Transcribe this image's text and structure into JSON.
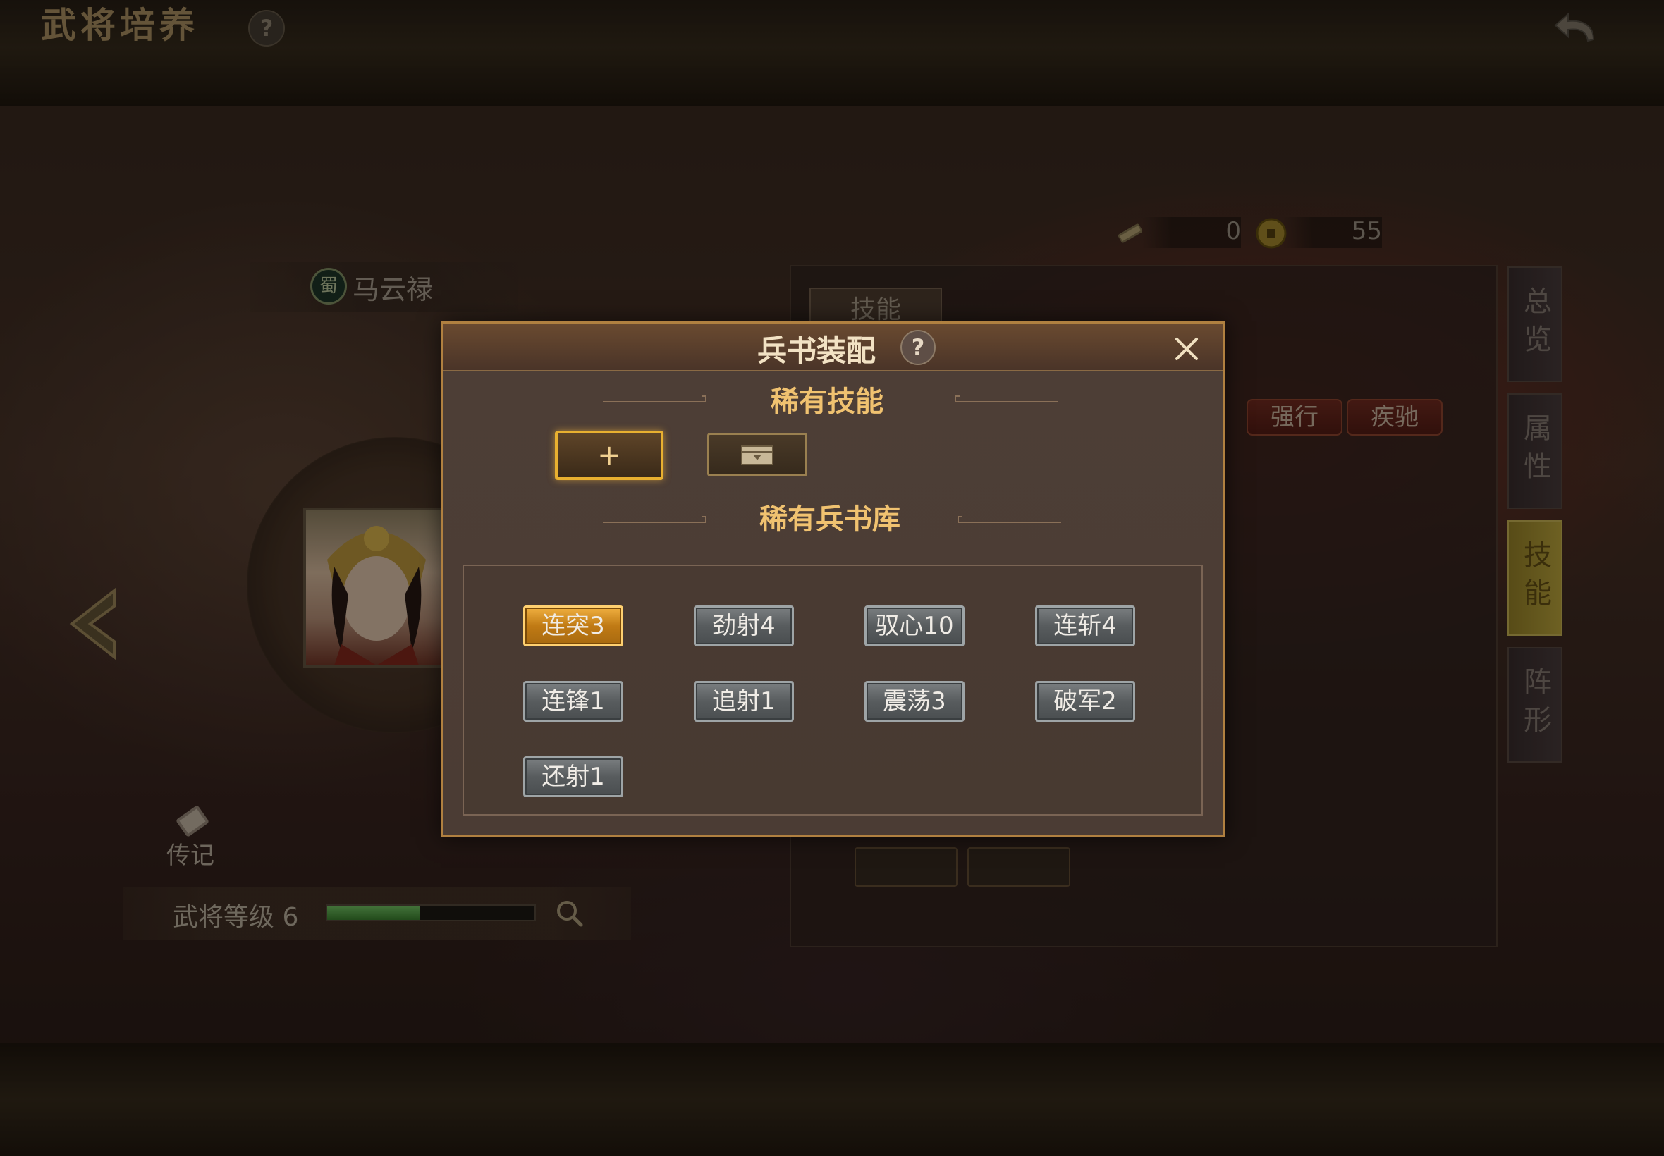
{
  "header": {
    "title": "武将培养",
    "help": "?"
  },
  "currency": [
    {
      "icon": "scroll-icon",
      "value": "0"
    },
    {
      "icon": "coin-icon",
      "value": "55"
    }
  ],
  "hero": {
    "faction": "蜀",
    "name": "马云禄",
    "bio_label": "传记",
    "level_label": "武将等级 6",
    "level_progress": 0.45
  },
  "background_panel": {
    "tab_label": "技能",
    "tags": [
      "强行",
      "疾驰"
    ]
  },
  "side_tabs": [
    {
      "label": "总览",
      "active": false
    },
    {
      "label": "属性",
      "active": false
    },
    {
      "label": "技能",
      "active": true
    },
    {
      "label": "阵形",
      "active": false
    }
  ],
  "modal": {
    "title": "兵书装配",
    "help": "?",
    "rare_skill_title": "稀有技能",
    "add_symbol": "+",
    "library_title": "稀有兵书库",
    "books": [
      {
        "label": "连突3",
        "selected": true
      },
      {
        "label": "劲射4",
        "selected": false
      },
      {
        "label": "驭心10",
        "selected": false
      },
      {
        "label": "连斩4",
        "selected": false
      },
      {
        "label": "连锋1",
        "selected": false
      },
      {
        "label": "追射1",
        "selected": false
      },
      {
        "label": "震荡3",
        "selected": false
      },
      {
        "label": "破军2",
        "selected": false
      },
      {
        "label": "还射1",
        "selected": false
      }
    ]
  },
  "colors": {
    "accent_gold": "#f0c270",
    "selected_book": "#e0a030",
    "progress_green": "#5fb04e"
  }
}
